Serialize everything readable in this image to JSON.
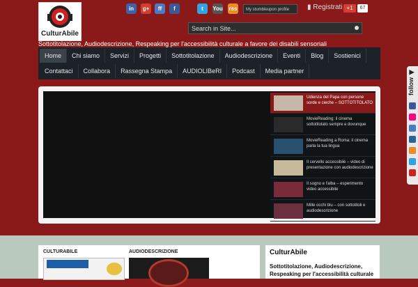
{
  "logo": {
    "name": "CulturAbile"
  },
  "tagline": "Sottotitolazione, Audiodescrizione, Respeaking per l'accessibilità culturale a favore dei disabili sensoriali",
  "social": [
    {
      "name": "linkedin-icon",
      "glyph": "in",
      "color": "#3b63a6"
    },
    {
      "name": "google-plus-icon",
      "glyph": "g+",
      "color": "#d23f31"
    },
    {
      "name": "friendfeed-icon",
      "glyph": "ff",
      "color": "#4c7bc4"
    },
    {
      "name": "facebook-icon",
      "glyph": "f",
      "color": "#3b5998"
    },
    {
      "name": "twitter-icon",
      "glyph": "t",
      "color": "#33a3e3"
    },
    {
      "name": "youtube-icon",
      "glyph": "You",
      "color": "#555555"
    },
    {
      "name": "rss-icon",
      "glyph": "rss",
      "color": "#f08a24"
    }
  ],
  "stumble_label": "My stumbleupon profile",
  "registrati": "Registrati",
  "gplus": {
    "label": "+1",
    "count": "67"
  },
  "search": {
    "placeholder": "Search in Site..."
  },
  "nav": {
    "row1": [
      "Home",
      "Chi siamo",
      "Servizi",
      "Progetti",
      "Sottotitolazione",
      "Audiodescrizione",
      "Eventi",
      "Blog",
      "Sostienici"
    ],
    "row2": [
      "Contattaci",
      "Collabora",
      "Rassegna Stampa",
      "AUDIOLIBeRI",
      "Podcast",
      "Media partner"
    ]
  },
  "slides": [
    {
      "text": "Udienza del Papa con persone sorde e cieche – SOTTOTITOLATO",
      "img": "#c7b7a8"
    },
    {
      "text": "MovieReading: il cinema sottotitolato sempre e dovunque",
      "img": "#2a2a2a"
    },
    {
      "text": "MovieReading a Roma: il cinema parla la tua lingua",
      "img": "#2a5070"
    },
    {
      "text": "Il cervello accessibile – video di presentazione con audiodescrizione",
      "img": "#c8b89c"
    },
    {
      "text": "Il sogno e l'alba – esperimento video accessibile",
      "img": "#7a2a3a"
    },
    {
      "text": "Mille occhi blu – con sottotitoli e audiodescrizione",
      "img": "#6a3040"
    }
  ],
  "follow": {
    "label": "follow",
    "icons": [
      {
        "name": "facebook-icon",
        "color": "#3b5998"
      },
      {
        "name": "flickr-icon",
        "color": "#ff0084"
      },
      {
        "name": "friendfeed-icon",
        "color": "#4c7bc4"
      },
      {
        "name": "linkedin-icon",
        "color": "#2a6496"
      },
      {
        "name": "rss-icon",
        "color": "#f08a24"
      },
      {
        "name": "twitter-icon",
        "color": "#33a3e3"
      },
      {
        "name": "youtube-icon",
        "color": "#cc2222"
      }
    ]
  },
  "columns": {
    "left": "CULTURABILE",
    "right": "AUDIODESCRIZIONE"
  },
  "sidebar": {
    "title": "CulturAbile",
    "text": "Sottotitolazione, Audiodescrizione, Respeaking per l'accessibilità culturale"
  },
  "colors": {
    "header_bg": "#8a1a1a",
    "nav_bg": "#1c2227",
    "footer_bg": "#b9c9bd"
  }
}
